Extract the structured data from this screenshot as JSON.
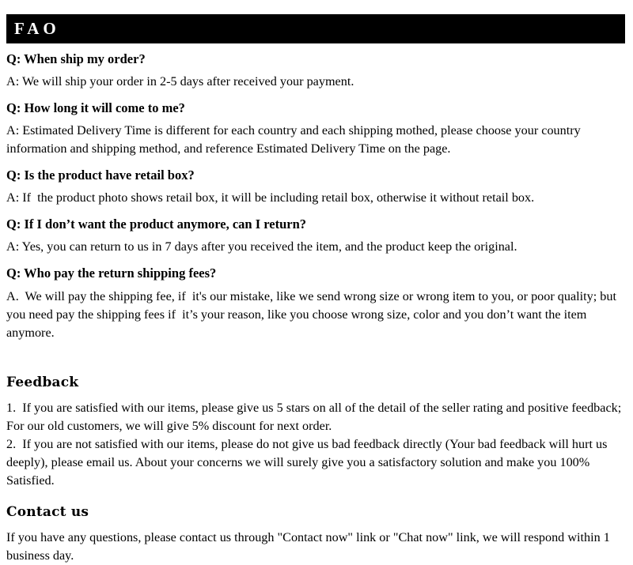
{
  "header": {
    "title": "FAO",
    "background_color": "#000000",
    "text_color": "#ffffff"
  },
  "faq": {
    "items": [
      {
        "question": "Q: When ship my order?",
        "answer": "A: We will ship your order in 2-5 days after received your payment."
      },
      {
        "question": "Q: How long it will come to me?",
        "answer": "A: Estimated Delivery Time is different for each country and each shipping mothed, please choose your country information and shipping method, and reference Estimated Delivery Time on the page."
      },
      {
        "question": "Q: Is the product have retail box?",
        "answer": "A: If  the product photo shows retail box, it will be including retail box, otherwise it without retail box."
      },
      {
        "question": "Q: If I don’t want the product anymore, can I return?",
        "answer": "A: Yes, you can return to us in 7 days after you received the item, and the product keep the original."
      },
      {
        "question": "Q: Who pay the return shipping fees?",
        "answer": "A.  We will pay the shipping fee, if  it's our mistake, like we send wrong size or wrong item to you, or poor quality; but you need pay the shipping fees if  it’s your reason, like you choose wrong size, color and you don’t want the item anymore."
      }
    ]
  },
  "feedback": {
    "heading": "Feedback",
    "paragraphs": [
      "1.  If you are satisfied with our items, please give us 5 stars on all of the detail of the seller rating and positive feedback; For our old customers, we will give 5% discount for next order.",
      "2.  If you are not satisfied with our items, please do not give us bad feedback directly (Your bad feedback will hurt us deeply), please email us. About your concerns we will surely give you a satisfactory solution and make you 100% Satisfied."
    ]
  },
  "contact": {
    "heading": "Contact us",
    "paragraphs": [
      "If you have any questions, please contact us through \"Contact now\" link or \"Chat now\" link, we will respond within 1 business day."
    ]
  }
}
